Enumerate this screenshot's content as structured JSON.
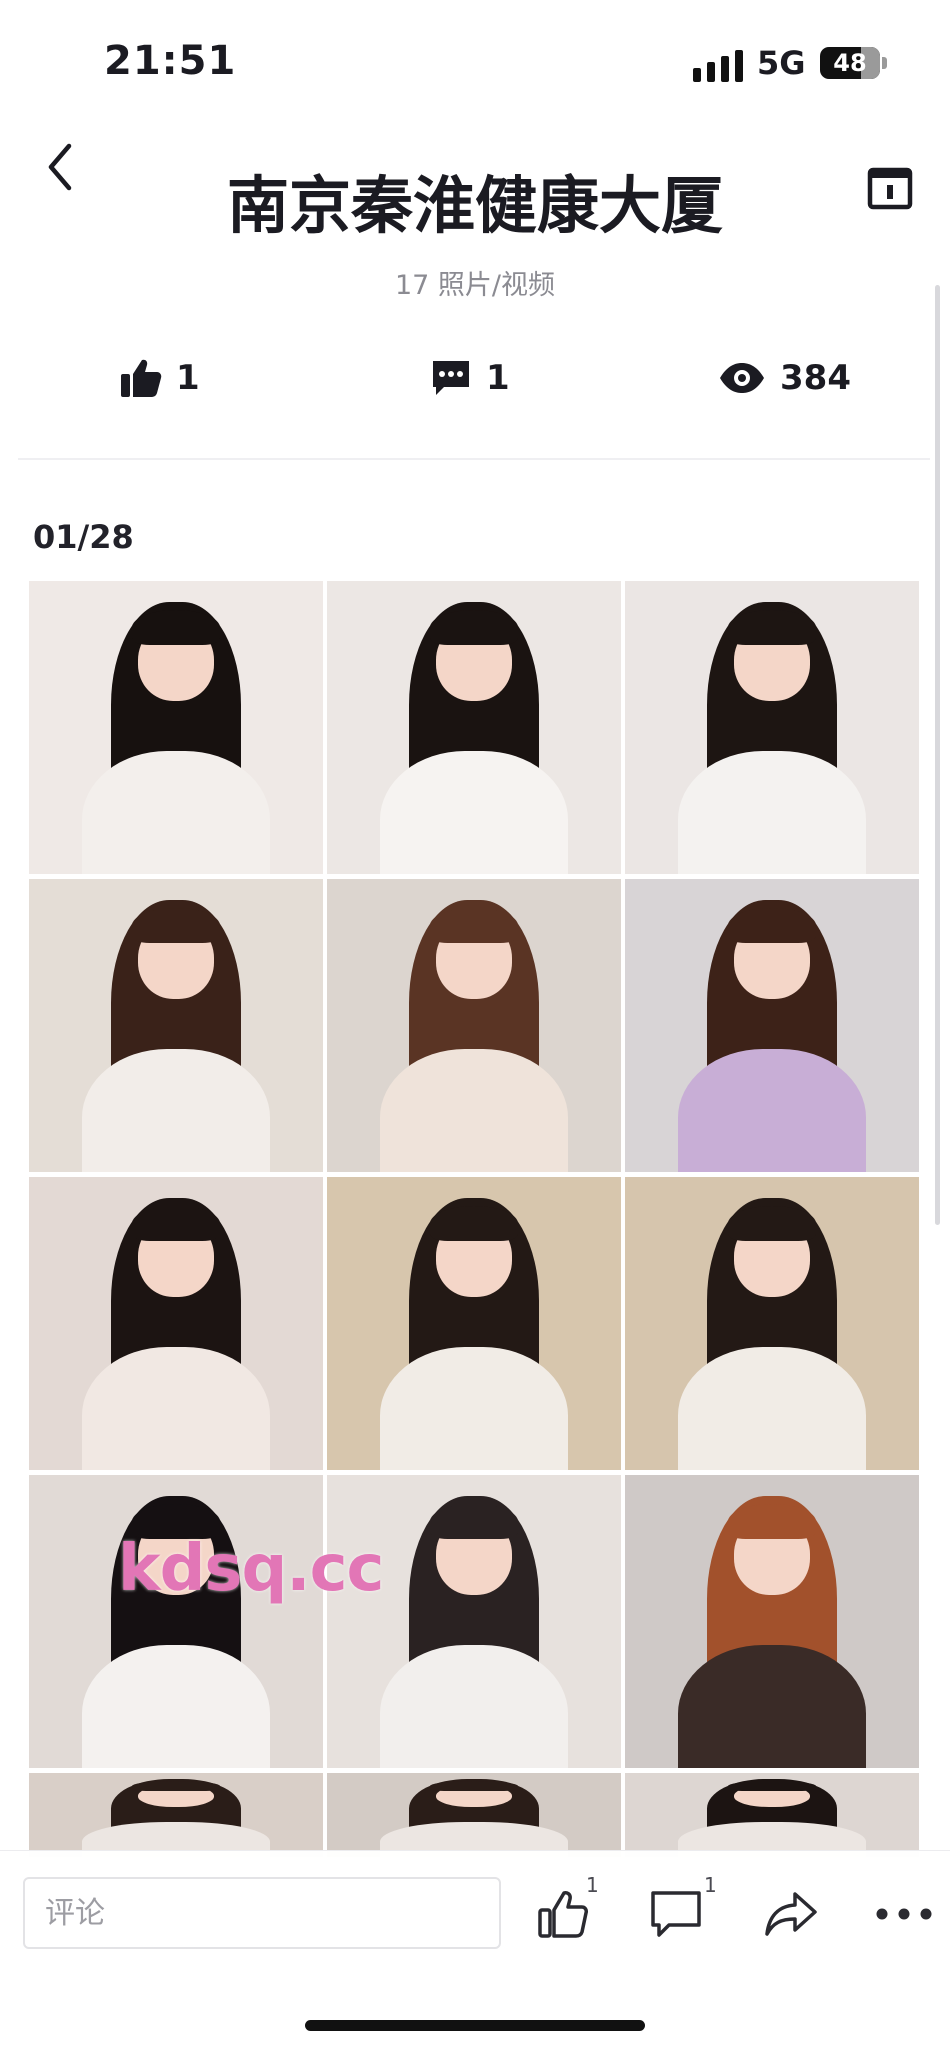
{
  "status_bar": {
    "time": "21:51",
    "network": "5G",
    "battery": "48",
    "battery_level_percent": 48
  },
  "header": {
    "title": "南京秦淮健康大厦",
    "subtitle": "17 照片/视频",
    "back_icon": "chevron-left-icon",
    "calendar_icon": "calendar-icon"
  },
  "stats": {
    "likes": "1",
    "comments": "1",
    "views": "384"
  },
  "gallery": {
    "counter": "01/28",
    "watermark": "kdsq.cc",
    "photos": [
      {
        "bg": "#efe9e6",
        "hair": "#17110f",
        "outfit": "#f3efec"
      },
      {
        "bg": "#ece7e4",
        "hair": "#1a1311",
        "outfit": "#f6f3f1"
      },
      {
        "bg": "#ebe6e4",
        "hair": "#1d1512",
        "outfit": "#f4f2f0"
      },
      {
        "bg": "#e4ddd6",
        "hair": "#3a2219",
        "outfit": "#f2ede9"
      },
      {
        "bg": "#dcd5cf",
        "hair": "#5a3424",
        "outfit": "#efe3da"
      },
      {
        "bg": "#d8d4d6",
        "hair": "#3d2218",
        "outfit": "#c8aed6"
      },
      {
        "bg": "#e3d9d4",
        "hair": "#1c1412",
        "outfit": "#f1e8e3"
      },
      {
        "bg": "#d7c6ad",
        "hair": "#231915",
        "outfit": "#f1ece6"
      },
      {
        "bg": "#d6c5ad",
        "hair": "#231915",
        "outfit": "#f1ece6"
      },
      {
        "bg": "#e1dad6",
        "hair": "#151012",
        "outfit": "#f4f1ef"
      },
      {
        "bg": "#e7e1dd",
        "hair": "#2a2222",
        "outfit": "#f2efed"
      },
      {
        "bg": "#cfc9c7",
        "hair": "#a2512c",
        "outfit": "#3a2b27"
      },
      {
        "bg": "#d9cfc8",
        "hair": "#2a1d18",
        "outfit": "#ece6e2"
      },
      {
        "bg": "#d3cbc5",
        "hair": "#2a1d18",
        "outfit": "#ece6e2"
      },
      {
        "bg": "#ddd6d2",
        "hair": "#1c1412",
        "outfit": "#ece6e2"
      }
    ]
  },
  "bottom_bar": {
    "comment_placeholder": "评论",
    "like_count": "1",
    "comment_count": "1",
    "like_icon": "thumbs-up-outline-icon",
    "comment_icon": "comment-outline-icon",
    "share_icon": "share-arrow-icon",
    "more_icon": "more-dots-icon"
  }
}
